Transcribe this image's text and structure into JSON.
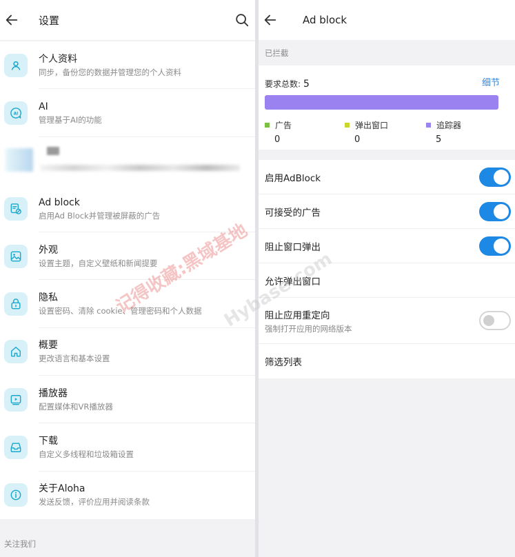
{
  "left": {
    "title": "设置",
    "items": [
      {
        "t1": "个人资料",
        "t2": "同步，备份您的数据并管理您的个人资料",
        "icon": "person-icon"
      },
      {
        "t1": "AI",
        "t2": "管理基于AI的功能",
        "icon": "ai-icon"
      },
      {
        "t1": "Ad block",
        "t2": "启用Ad Block并管理被屏蔽的广告",
        "icon": "ad-block-icon"
      },
      {
        "t1": "外观",
        "t2": "设置主题，自定义壁纸和新闻提要",
        "icon": "image-icon"
      },
      {
        "t1": "隐私",
        "t2": "设置密码、清除 cookie、管理密码和个人数据",
        "icon": "lock-icon"
      },
      {
        "t1": "概要",
        "t2": "更改语言和基本设置",
        "icon": "home-icon"
      },
      {
        "t1": "播放器",
        "t2": "配置媒体和VR播放器",
        "icon": "player-icon"
      },
      {
        "t1": "下载",
        "t2": "自定义多线程和垃圾箱设置",
        "icon": "download-tray-icon"
      },
      {
        "t1": "关于Aloha",
        "t2": "发送反馈，评价应用并阅读条款",
        "icon": "info-icon"
      }
    ],
    "footer": "关注我们"
  },
  "right": {
    "title": "Ad block",
    "blocked_header": "已拦截",
    "total_label": "要求总数:",
    "total_value": "5",
    "detail_link": "细节",
    "bar_fraction": 1.0,
    "legend": [
      {
        "label": "广告",
        "value": "0",
        "color": "#7cc242"
      },
      {
        "label": "弹出窗口",
        "value": "0",
        "color": "#c9d62e"
      },
      {
        "label": "追踪器",
        "value": "5",
        "color": "#9b82f1"
      }
    ],
    "settings": [
      {
        "label": "启用AdBlock",
        "toggle": "on"
      },
      {
        "label": "可接受的广告",
        "toggle": "on"
      },
      {
        "label": "阻止窗口弹出",
        "toggle": "on"
      },
      {
        "label": "允许弹出窗口",
        "toggle": "none"
      },
      {
        "label": "阻止应用重定向",
        "sub": "强制打开应用的网络版本",
        "toggle": "off"
      },
      {
        "label": "筛选列表",
        "toggle": "none"
      }
    ]
  },
  "watermark": "记得收藏:黑域基地",
  "watermark_site": "Hybase.com",
  "colors": {
    "accent": "#1e88e5",
    "link": "#3a86d6",
    "icon_bg": "#d8f1f8",
    "icon_fg": "#1aa7cc"
  }
}
